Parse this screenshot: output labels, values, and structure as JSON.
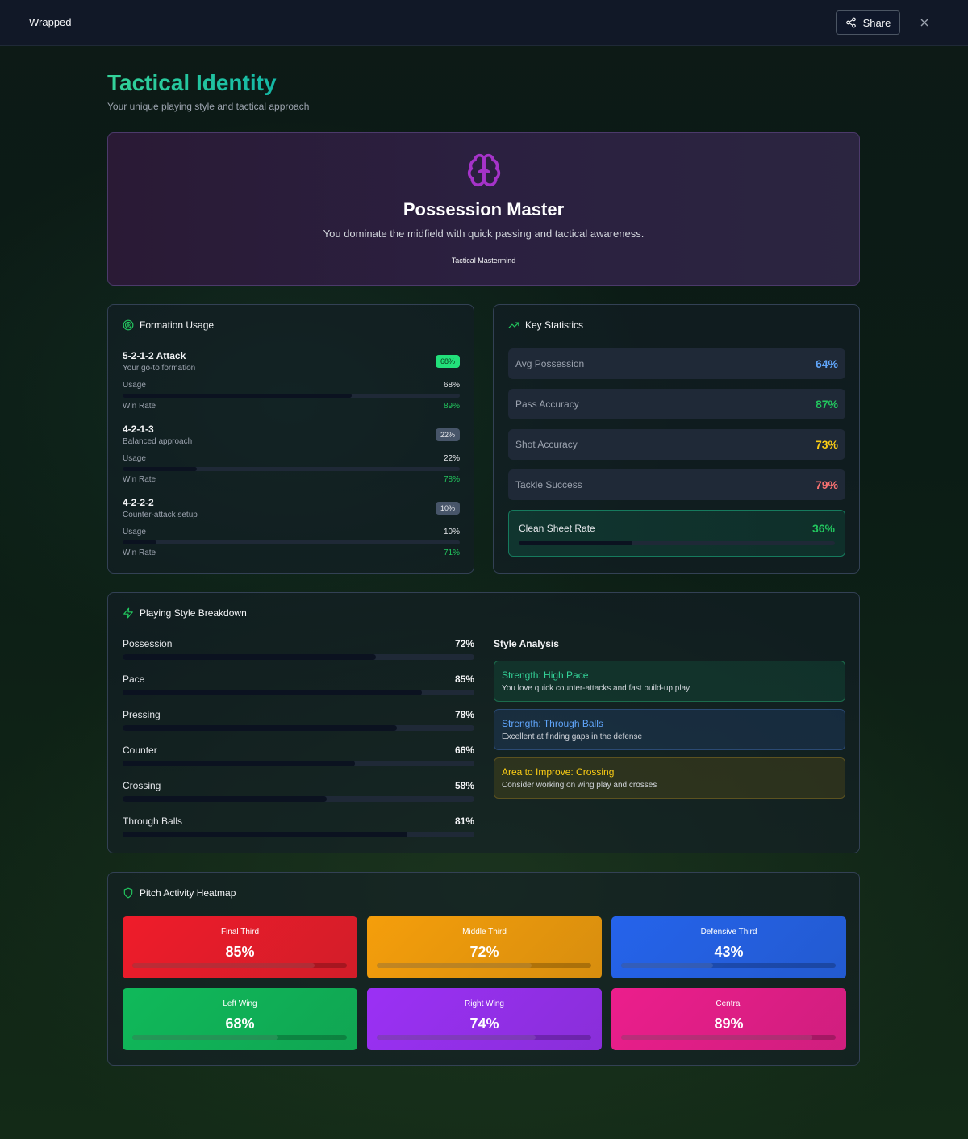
{
  "topbar": {
    "brand": "Wrapped",
    "share_label": "Share"
  },
  "page": {
    "title": "Tactical Identity",
    "subtitle": "Your unique playing style and tactical approach"
  },
  "hero": {
    "icon": "brain-icon",
    "title": "Possession Master",
    "description": "You dominate the midfield with quick passing and tactical awareness.",
    "badge": "Tactical Mastermind"
  },
  "formation": {
    "title": "Formation Usage",
    "usage_label": "Usage",
    "winrate_label": "Win Rate",
    "items": [
      {
        "name": "5-2-1-2 Attack",
        "sub": "Your go-to formation",
        "badge": "68%",
        "usage": "68%",
        "usage_pct": 68,
        "winrate": "89%",
        "primary": true
      },
      {
        "name": "4-2-1-3",
        "sub": "Balanced approach",
        "badge": "22%",
        "usage": "22%",
        "usage_pct": 22,
        "winrate": "78%",
        "primary": false
      },
      {
        "name": "4-2-2-2",
        "sub": "Counter-attack setup",
        "badge": "10%",
        "usage": "10%",
        "usage_pct": 10,
        "winrate": "71%",
        "primary": false
      }
    ]
  },
  "keystats": {
    "title": "Key Statistics",
    "rows": [
      {
        "label": "Avg Possession",
        "value": "64%",
        "color": "#60a5fa"
      },
      {
        "label": "Pass Accuracy",
        "value": "87%",
        "color": "#22c55e"
      },
      {
        "label": "Shot Accuracy",
        "value": "73%",
        "color": "#facc15"
      },
      {
        "label": "Tackle Success",
        "value": "79%",
        "color": "#f87171"
      }
    ],
    "clean_sheet": {
      "label": "Clean Sheet Rate",
      "value": "36%",
      "pct": 36
    }
  },
  "style": {
    "title": "Playing Style Breakdown",
    "rows": [
      {
        "label": "Possession",
        "value": "72%",
        "pct": 72
      },
      {
        "label": "Pace",
        "value": "85%",
        "pct": 85
      },
      {
        "label": "Pressing",
        "value": "78%",
        "pct": 78
      },
      {
        "label": "Counter",
        "value": "66%",
        "pct": 66
      },
      {
        "label": "Crossing",
        "value": "58%",
        "pct": 58
      },
      {
        "label": "Through Balls",
        "value": "81%",
        "pct": 81
      }
    ],
    "analysis_title": "Style Analysis",
    "analysis": [
      {
        "head": "Strength: High Pace",
        "body": "You love quick counter-attacks and fast build-up play",
        "color": "#34d399"
      },
      {
        "head": "Strength: Through Balls",
        "body": "Excellent at finding gaps in the defense",
        "color": "#60a5fa"
      },
      {
        "head": "Area to Improve: Crossing",
        "body": "Consider working on wing play and crosses",
        "color": "#facc15"
      }
    ]
  },
  "heatmap": {
    "title": "Pitch Activity Heatmap",
    "zones": [
      {
        "label": "Final Third",
        "value": "85%",
        "pct": 85,
        "color": "#ef1c2a"
      },
      {
        "label": "Middle Third",
        "value": "72%",
        "pct": 72,
        "color": "#f59e0b"
      },
      {
        "label": "Defensive Third",
        "value": "43%",
        "pct": 43,
        "color": "#2563eb"
      },
      {
        "label": "Left Wing",
        "value": "68%",
        "pct": 68,
        "color": "#10b95a"
      },
      {
        "label": "Right Wing",
        "value": "74%",
        "pct": 74,
        "color": "#9b30f5"
      },
      {
        "label": "Central",
        "value": "89%",
        "pct": 89,
        "color": "#ec1e8c"
      }
    ]
  }
}
